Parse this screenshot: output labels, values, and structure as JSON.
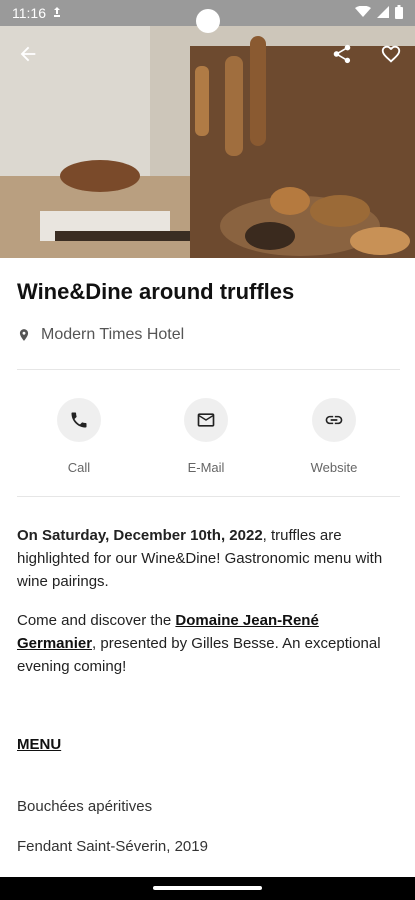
{
  "status": {
    "time": "11:16"
  },
  "event": {
    "title": "Wine&Dine around truffles",
    "location": "Modern Times Hotel"
  },
  "actions": {
    "call": "Call",
    "email": "E-Mail",
    "website": "Website"
  },
  "description": {
    "p1_bold": "On Saturday, December 10th, 2022",
    "p1_rest": ", truffles are highlighted for our Wine&Dine! Gastronomic menu with wine pairings.",
    "p2_before": "Come and discover the ",
    "p2_link": "Domaine Jean-René Germanier",
    "p2_after": ", presented by Gilles Besse. An exceptional evening coming!"
  },
  "menu": {
    "heading": "MENU",
    "items": [
      "Bouchées apéritives",
      "Fendant Saint-Séverin, 2019"
    ]
  },
  "icons": {
    "back": "arrow-back-icon",
    "share": "share-icon",
    "favorite": "heart-outline-icon",
    "location": "location-pin-icon",
    "phone": "phone-icon",
    "mail": "mail-icon",
    "link": "link-icon"
  }
}
